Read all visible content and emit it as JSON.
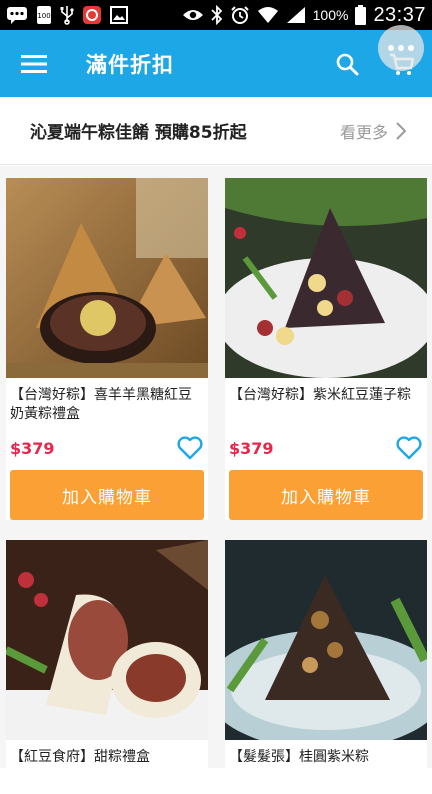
{
  "status_bar": {
    "battery_percent": "100%",
    "time": "23:37"
  },
  "app_bar": {
    "title": "滿件折扣",
    "accent_color": "#1ea7e7"
  },
  "promo": {
    "title": "沁夏端午粽佳餚  預購85折起",
    "more_label": "看更多"
  },
  "products": [
    {
      "name": "【台灣好粽】喜羊羊黑糖紅豆奶黃粽禮盒",
      "price": "$379",
      "button_label": "加入購物車"
    },
    {
      "name": "【台灣好粽】紫米紅豆蓮子粽",
      "price": "$379",
      "button_label": "加入購物車"
    },
    {
      "name": "【紅豆食府】甜粽禮盒",
      "price": "",
      "button_label": ""
    },
    {
      "name": "【髮髮張】桂圓紫米粽",
      "price": "",
      "button_label": ""
    }
  ],
  "colors": {
    "price": "#e8254b",
    "button": "#fba034",
    "heart": "#1ea7e7"
  }
}
